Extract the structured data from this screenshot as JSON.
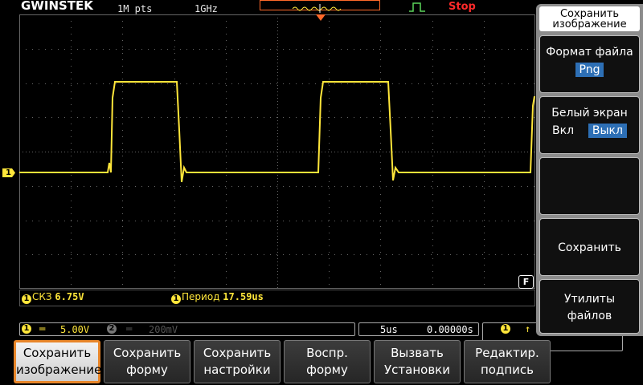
{
  "header": {
    "logo": "GWINSTEK",
    "memory": "1M pts",
    "sample_rate": "1GHz",
    "run_state": "Stop"
  },
  "channel_marker": "1",
  "measurements": [
    {
      "channel": "1",
      "label": "СКЗ",
      "value": "6.75V"
    },
    {
      "channel": "1",
      "label": "Период",
      "value": "17.59us"
    }
  ],
  "status": {
    "ch1_scale": "5.00V",
    "ch2_scale": "200mV",
    "timebase": "5us",
    "position": "0.00000s",
    "trigger_channel": "1"
  },
  "sidepanel": {
    "title": "Сохранить изображение",
    "file_format_label": "Формат файла",
    "file_format_value": "Png",
    "white_screen_label": "Белый экран",
    "white_on": "Вкл",
    "white_off": "Выкл",
    "save_label": "Сохранить",
    "file_utils_label": "Утилиты файлов"
  },
  "soft_buttons": [
    {
      "line1": "Сохранить",
      "line2": "изображение"
    },
    {
      "line1": "Сохранить",
      "line2": "форму"
    },
    {
      "line1": "Сохранить",
      "line2": "настройки"
    },
    {
      "line1": "Воспр.",
      "line2": "форму"
    },
    {
      "line1": "Вызвать",
      "line2": "Установки"
    },
    {
      "line1": "Редактир.",
      "line2": "подпись"
    }
  ],
  "flags": {
    "fine": "F"
  },
  "colors": {
    "ch1": "#ffe63a",
    "accent": "#e8862a",
    "stop": "#ff2a2a",
    "selected": "#2d6fb5"
  }
}
